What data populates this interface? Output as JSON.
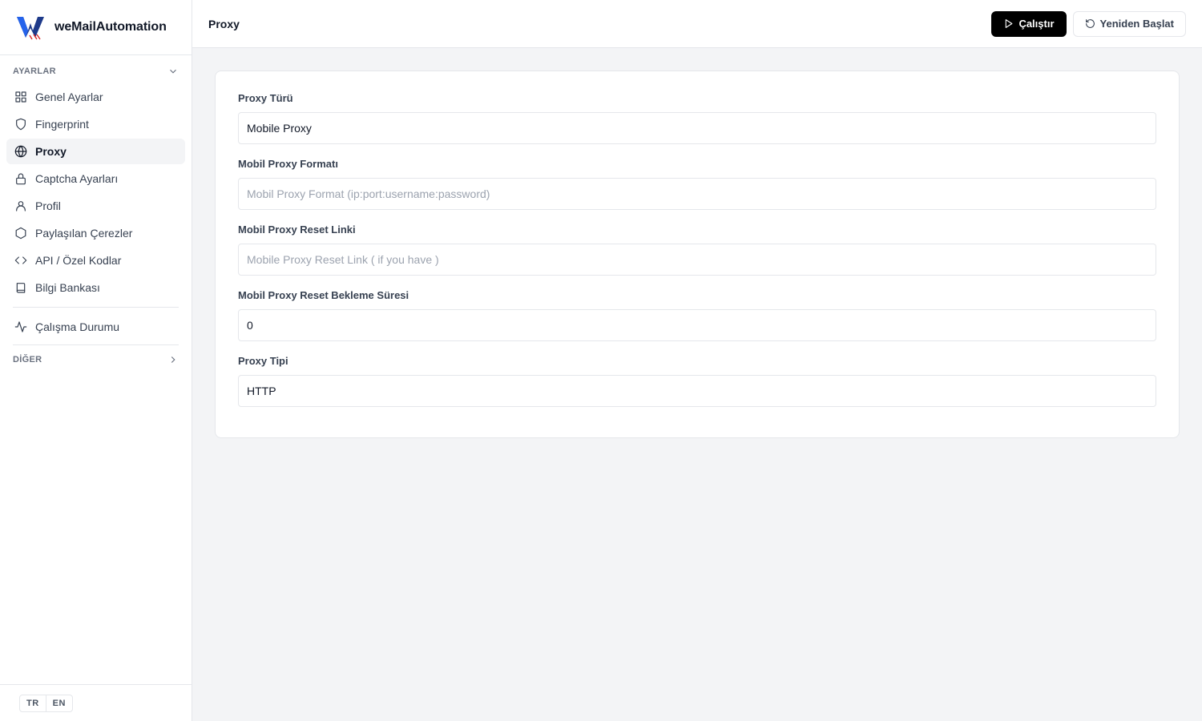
{
  "app": {
    "name": "weMailAutomation",
    "accent": "#000000",
    "logo_colors": [
      "#1e3a8a",
      "#2563eb",
      "#dc2626"
    ]
  },
  "sidebar": {
    "section_settings": "AYARLAR",
    "items": [
      {
        "label": "Genel Ayarlar",
        "icon": "grid-icon"
      },
      {
        "label": "Fingerprint",
        "icon": "shield-icon"
      },
      {
        "label": "Proxy",
        "icon": "globe-icon",
        "active": true
      },
      {
        "label": "Captcha Ayarları",
        "icon": "lock-icon"
      },
      {
        "label": "Profil",
        "icon": "user-icon"
      },
      {
        "label": "Paylaşılan Çerezler",
        "icon": "hexagon-icon"
      },
      {
        "label": "API / Özel Kodlar",
        "icon": "code-icon"
      },
      {
        "label": "Bilgi Bankası",
        "icon": "book-icon"
      }
    ],
    "status_item": {
      "label": "Çalışma Durumu",
      "icon": "activity-icon"
    },
    "section_other": "DİĞER",
    "languages": [
      "TR",
      "EN"
    ]
  },
  "header": {
    "title": "Proxy",
    "run_label": "Çalıştır",
    "restart_label": "Yeniden Başlat"
  },
  "form": {
    "proxy_type": {
      "label": "Proxy Türü",
      "value": "Mobile Proxy"
    },
    "mobile_format": {
      "label": "Mobil Proxy Formatı",
      "placeholder": "Mobil Proxy Format (ip:port:username:password)"
    },
    "reset_link": {
      "label": "Mobil Proxy Reset Linki",
      "placeholder": "Mobile Proxy Reset Link ( if you have )"
    },
    "reset_wait": {
      "label": "Mobil Proxy Reset Bekleme Süresi",
      "value": "0"
    },
    "proxy_protocol": {
      "label": "Proxy Tipi",
      "value": "HTTP"
    }
  }
}
